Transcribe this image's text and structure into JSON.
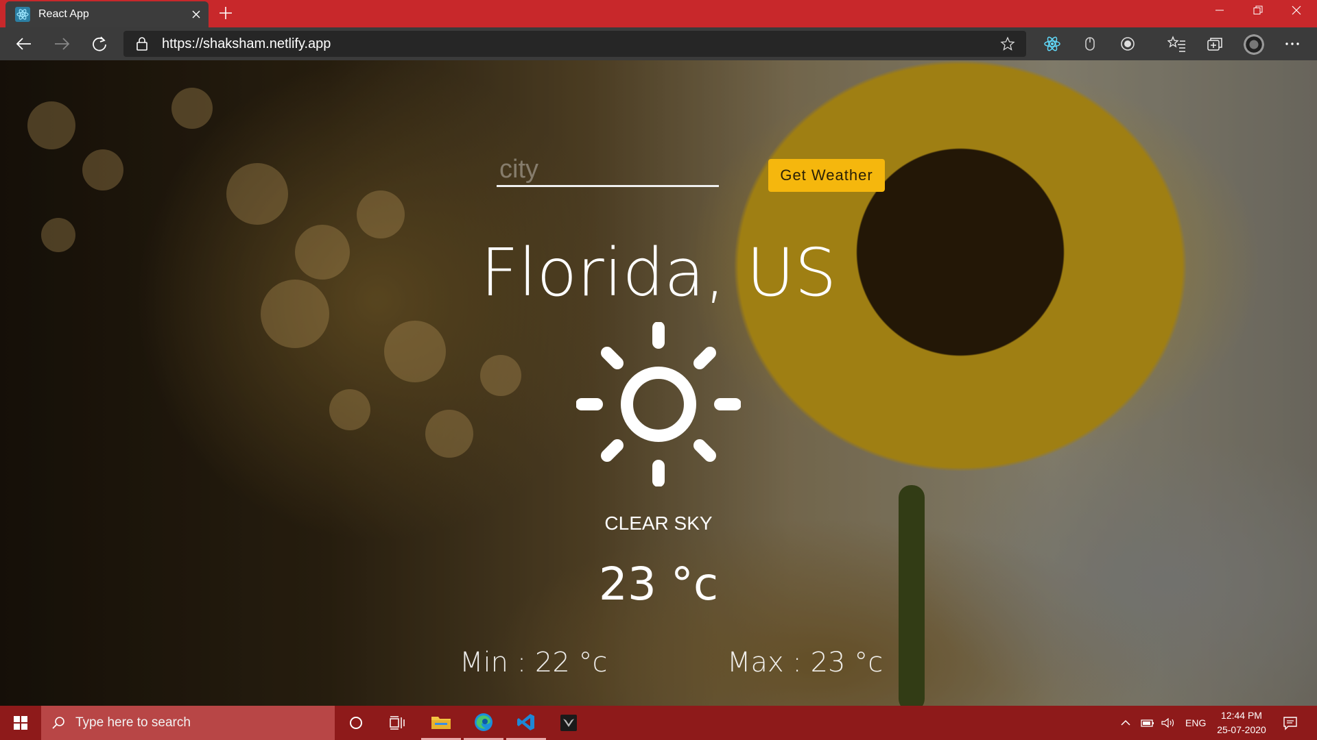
{
  "browser": {
    "tab_title": "React App",
    "url": "https://shaksham.netlify.app"
  },
  "app": {
    "city_placeholder": "city",
    "button_label": "Get Weather",
    "location": "Florida, US",
    "condition": "CLEAR SKY",
    "temperature": "23 °c",
    "min_label": "Min : 22 °c",
    "max_label": "Max : 23 °c",
    "weather_icon": "sun-icon"
  },
  "taskbar": {
    "search_placeholder": "Type here to search",
    "language": "ENG",
    "time": "12:44 PM",
    "date": "25-07-2020"
  },
  "colors": {
    "titlebar": "#c8282b",
    "taskbar": "#8e1a1a",
    "button": "#f5b70d"
  }
}
